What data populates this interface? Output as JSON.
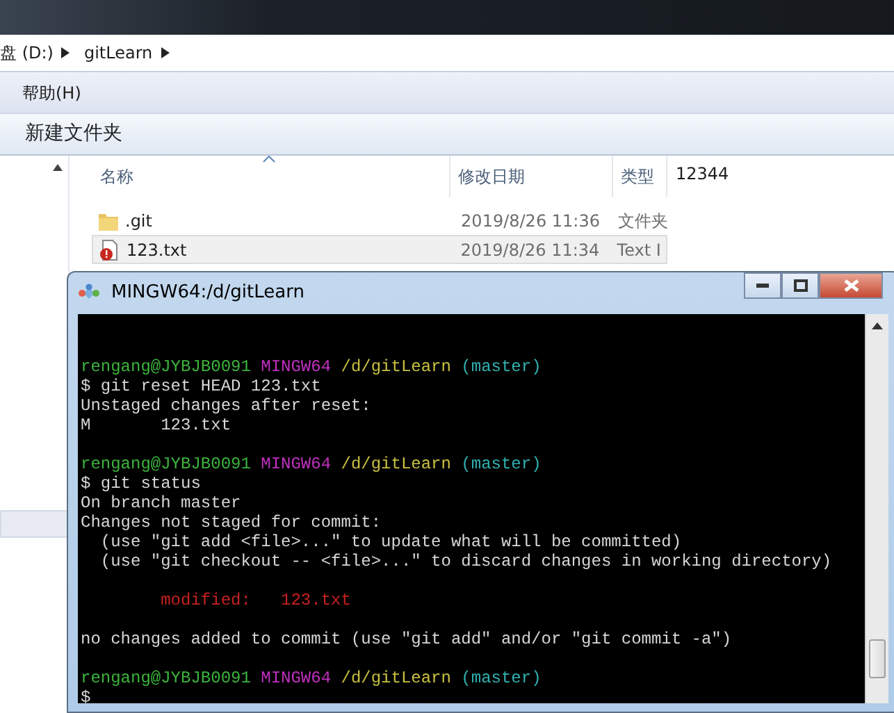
{
  "explorer": {
    "breadcrumb": [
      {
        "label": "盘 (D:)"
      },
      {
        "label": "gitLearn"
      }
    ],
    "menu": [
      {
        "label": "帮助(H)"
      }
    ],
    "toolbar": [
      {
        "label": "新建文件夹"
      }
    ],
    "columns": [
      {
        "label": "名称",
        "sorted": true
      },
      {
        "label": "修改日期",
        "sorted": false
      },
      {
        "label": "类型",
        "sorted": false
      }
    ],
    "files": [
      {
        "kind": "folder",
        "name": ".git",
        "date": "2019/8/26 11:36",
        "type": "文件夹",
        "selected": false
      },
      {
        "kind": "text-file",
        "name": "123.txt",
        "date": "2019/8/26 11:34",
        "type": "Text I",
        "selected": true
      }
    ],
    "preview": "12344"
  },
  "terminal": {
    "title": "MINGW64:/d/gitLearn",
    "lines": [
      {
        "kind": "blank"
      },
      {
        "kind": "blank"
      },
      {
        "kind": "prompt",
        "user": "rengang@JYBJB0091",
        "shell": "MINGW64",
        "path": "/d/gitLearn",
        "branch": "(master)"
      },
      {
        "kind": "output",
        "text": "$ git reset HEAD 123.txt"
      },
      {
        "kind": "output",
        "text": "Unstaged changes after reset:"
      },
      {
        "kind": "output",
        "text": "M       123.txt"
      },
      {
        "kind": "blank"
      },
      {
        "kind": "prompt",
        "user": "rengang@JYBJB0091",
        "shell": "MINGW64",
        "path": "/d/gitLearn",
        "branch": "(master)"
      },
      {
        "kind": "output",
        "text": "$ git status"
      },
      {
        "kind": "output",
        "text": "On branch master"
      },
      {
        "kind": "output",
        "text": "Changes not staged for commit:"
      },
      {
        "kind": "output",
        "text": "  (use \"git add <file>...\" to update what will be committed)"
      },
      {
        "kind": "output",
        "text": "  (use \"git checkout -- <file>...\" to discard changes in working directory)"
      },
      {
        "kind": "blank"
      },
      {
        "kind": "error",
        "text": "        modified:   123.txt"
      },
      {
        "kind": "blank"
      },
      {
        "kind": "output",
        "text": "no changes added to commit (use \"git add\" and/or \"git commit -a\")"
      },
      {
        "kind": "blank"
      },
      {
        "kind": "prompt",
        "user": "rengang@JYBJB0091",
        "shell": "MINGW64",
        "path": "/d/gitLearn",
        "branch": "(master)"
      },
      {
        "kind": "output",
        "text": "$"
      }
    ]
  }
}
